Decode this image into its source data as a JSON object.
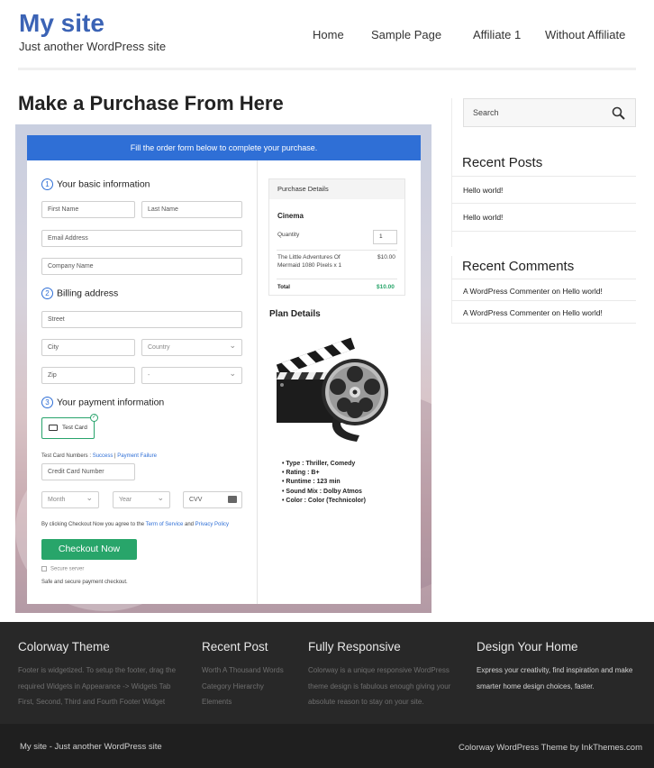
{
  "site": {
    "title": "My site",
    "description": "Just another WordPress site"
  },
  "nav": {
    "items": [
      "Home",
      "Sample Page",
      "Affiliate 1",
      "Without Affiliate"
    ]
  },
  "main": {
    "page_title": "Make a Purchase From Here"
  },
  "form": {
    "banner": "Fill the order form below to complete your purchase.",
    "step1_num": "1",
    "step1_label": "Your basic information",
    "first_name_placeholder": "First Name",
    "last_name_placeholder": "Last Name",
    "email_placeholder": "Email Address",
    "company_placeholder": "Company Name",
    "step2_num": "2",
    "step2_label": "Billing address",
    "street_placeholder": "Street",
    "city_placeholder": "City",
    "country_value": "Country",
    "zip_placeholder": "Zip",
    "state_value": "-",
    "step3_num": "3",
    "step3_label": "Your payment information",
    "test_card_label": "Test Card",
    "test_card_numbers_prefix": "Test Card Numbers : ",
    "success_link": "Success",
    "separator": " | ",
    "failure_link": "Payment Failure",
    "credit_card_placeholder": "Credit Card Number",
    "month_value": "Month",
    "year_value": "Year",
    "cvv_placeholder": "CVV",
    "terms_prefix": "By clicking Checkout Now you agree to the ",
    "terms_link": "Term of Service",
    "terms_and": " and ",
    "privacy_link": "Privacy Policy",
    "checkout_label": "Checkout Now",
    "secure_label": "Secure server",
    "safe_label": "Safe and secure payment checkout."
  },
  "purchase": {
    "header": "Purchase Details",
    "product": "Cinema",
    "quantity_label": "Quantity",
    "quantity_value": "1",
    "item_line1": "The Little Adventures Of",
    "item_line2": "Mermaid 1080 Pixels x 1",
    "item_price": "$10.00",
    "total_label": "Total",
    "total_value": "$10.00",
    "total_color": "#28a56a"
  },
  "plan": {
    "title": "Plan Details",
    "image_icon": "film-clapperboard-reel-icon",
    "details": [
      "Type : Thriller, Comedy",
      "Rating : B+",
      "Runtime : 123 min",
      "Sound Mix : Dolby Atmos",
      "Color : Color (Technicolor)"
    ]
  },
  "sidebar": {
    "search_placeholder": "Search",
    "recent_posts_heading": "Recent Posts",
    "recent_posts": [
      "Hello world!",
      "Hello world!"
    ],
    "recent_comments_heading": "Recent Comments",
    "recent_comments": [
      {
        "author": "A WordPress Commenter",
        "on": " on ",
        "post": "Hello world!"
      },
      {
        "author": "A WordPress Commenter",
        "on": " on ",
        "post": "Hello world!"
      }
    ]
  },
  "footer": {
    "col1_heading": "Colorway Theme",
    "col1_line1": "Footer is widgetized. To setup the footer, drag the",
    "col1_line2": "required Widgets in Appearance -> Widgets Tab",
    "col1_line3": "First, Second, Third and Fourth Footer Widget",
    "col2_heading": "Recent Post",
    "col2_line1": "Worth A Thousand Words",
    "col2_line2": "Category Hierarchy",
    "col2_line3": "Elements",
    "col3_heading": "Fully Responsive",
    "col3_line1": "Colorway is a unique responsive WordPress",
    "col3_line2": "theme design is fabulous enough giving your",
    "col3_line3": "absolute reason to stay on your site.",
    "col4_heading": "Design Your Home",
    "col4_line1": "Express your creativity, find inspiration and make",
    "col4_line2": "smarter home design choices, faster.",
    "bottom_left": "My site - Just another WordPress site",
    "bottom_right": "Colorway WordPress Theme by InkThemes.com"
  },
  "colors": {
    "brand": "#3b63b5",
    "banner": "#2f6fd6",
    "checkout": "#28a56a",
    "footer_bg": "#282828"
  }
}
